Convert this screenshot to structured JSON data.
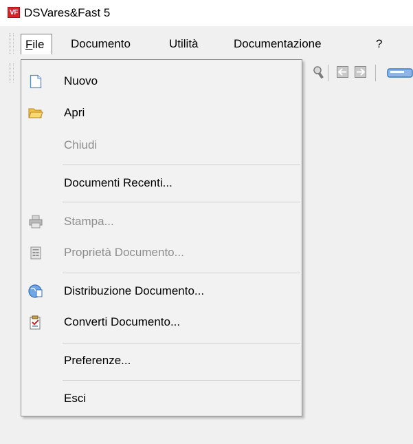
{
  "window": {
    "title": "DSVares&Fast 5",
    "app_icon_text": "VF"
  },
  "menubar": {
    "items": [
      {
        "label_prefix": "F",
        "label_rest": "ile",
        "open": true
      },
      {
        "label": "Documento"
      },
      {
        "label": "Utilità"
      },
      {
        "label": "Documentazione"
      },
      {
        "label": "?"
      }
    ]
  },
  "file_menu": {
    "items": [
      {
        "label": "Nuovo",
        "icon": "new-document-icon",
        "enabled": true
      },
      {
        "label": "Apri",
        "icon": "open-folder-icon",
        "enabled": true
      },
      {
        "label": "Chiudi",
        "icon": null,
        "enabled": false
      },
      {
        "label": "Documenti Recenti...",
        "icon": null,
        "enabled": true
      },
      {
        "label": "Stampa...",
        "icon": "printer-icon",
        "enabled": false
      },
      {
        "label": "Proprietà Documento...",
        "icon": "properties-icon",
        "enabled": false
      },
      {
        "label": "Distribuzione Documento...",
        "icon": "distribution-icon",
        "enabled": true
      },
      {
        "label": "Converti Documento...",
        "icon": "convert-icon",
        "enabled": true
      },
      {
        "label": "Preferenze...",
        "icon": null,
        "enabled": true
      },
      {
        "label": "Esci",
        "icon": null,
        "enabled": true
      }
    ]
  },
  "toolbar": {
    "icons": [
      "search-icon",
      "back-arrow-icon",
      "forward-arrow-icon",
      "tool-icon"
    ]
  },
  "colors": {
    "accent_blue": "#3b78c2",
    "folder_yellow": "#f5c342",
    "app_red": "#d8232a"
  }
}
